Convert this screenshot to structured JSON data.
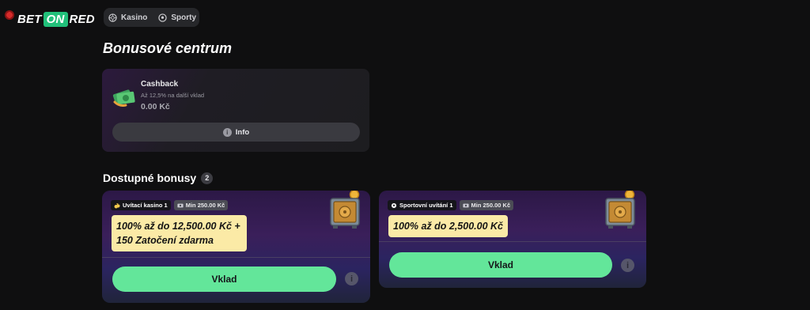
{
  "brand": {
    "part1": "BET",
    "part2": "ON",
    "part3": "RED"
  },
  "nav": {
    "items": [
      {
        "label": "Kasino",
        "icon": "casino-chip-icon"
      },
      {
        "label": "Sporty",
        "icon": "soccer-ball-icon"
      }
    ]
  },
  "page": {
    "title": "Bonusové centrum"
  },
  "cashback": {
    "title": "Cashback",
    "subtitle": "Až 12,5% na další vklad",
    "amount": "0.00 Kč",
    "info_label": "Info",
    "info_icon_text": "i"
  },
  "available": {
    "title": "Dostupné bonusy",
    "count": "2"
  },
  "bonuses": [
    {
      "tag": "Uvítací kasino 1",
      "tag_icon": "money-bag-icon",
      "min": "Min 250.00 Kč",
      "offer": "100% až do 12,500.00 Kč + 150 Zatočení zdarma",
      "button": "Vklad",
      "info_text": "i"
    },
    {
      "tag": "Sportovní uvítání 1",
      "tag_icon": "soccer-ball-icon",
      "min": "Min 250.00 Kč",
      "offer": "100% až do 2,500.00 Kč",
      "button": "Vklad",
      "info_text": "i"
    }
  ],
  "colors": {
    "accent_green": "#63e69a",
    "offer_yellow": "#fbeaa6",
    "background": "#0f0f10"
  }
}
